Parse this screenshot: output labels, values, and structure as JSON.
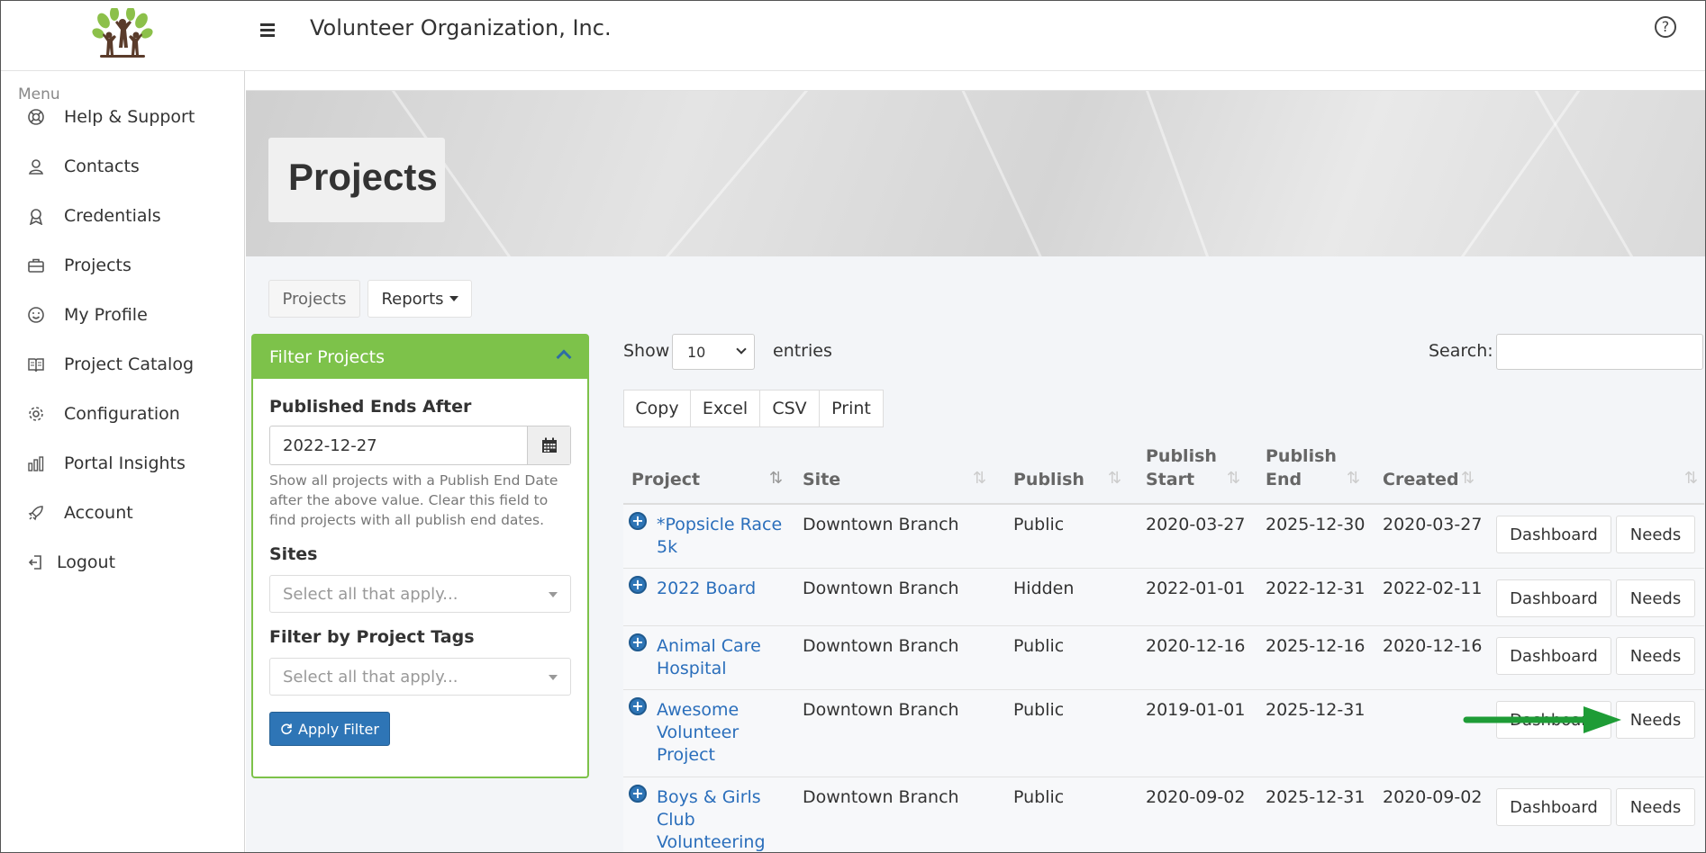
{
  "header": {
    "app_title": "Volunteer Organization, Inc.",
    "logo": "volunteer-tree-logo",
    "help_icon": "question-circle-icon"
  },
  "sidebar": {
    "menu_label": "Menu",
    "items": [
      {
        "label": "Help & Support",
        "icon": "lifebuoy-icon"
      },
      {
        "label": "Contacts",
        "icon": "contacts-icon"
      },
      {
        "label": "Credentials",
        "icon": "award-icon"
      },
      {
        "label": "Projects",
        "icon": "briefcase-icon"
      },
      {
        "label": "My Profile",
        "icon": "smile-icon"
      },
      {
        "label": "Project Catalog",
        "icon": "book-icon"
      },
      {
        "label": "Configuration",
        "icon": "gear-icon"
      },
      {
        "label": "Portal Insights",
        "icon": "bar-chart-icon"
      },
      {
        "label": "Account",
        "icon": "rocket-icon"
      },
      {
        "label": "Logout",
        "icon": "logout-icon"
      }
    ]
  },
  "page": {
    "title": "Projects",
    "tabs": [
      {
        "label": "Projects"
      },
      {
        "label": "Reports"
      }
    ]
  },
  "filter": {
    "title": "Filter Projects",
    "published_ends_after_label": "Published Ends After",
    "published_ends_after_value": "2022-12-27",
    "help_text": "Show all projects with a Publish End Date after the above value. Clear this field to find projects with all publish end dates.",
    "sites_label": "Sites",
    "sites_placeholder": "Select all that apply...",
    "tags_label": "Filter by Project Tags",
    "tags_placeholder": "Select all that apply...",
    "apply_label": "Apply Filter"
  },
  "table_controls": {
    "show_label": "Show",
    "page_size": "10",
    "entries_label": "entries",
    "search_label": "Search:",
    "search_value": "",
    "export_buttons": [
      "Copy",
      "Excel",
      "CSV",
      "Print"
    ]
  },
  "table": {
    "columns": {
      "project": "Project",
      "site": "Site",
      "publish": "Publish",
      "publish_start_1": "Publish",
      "publish_start_2": "Start",
      "publish_end_1": "Publish",
      "publish_end_2": "End",
      "created": "Created"
    },
    "rows": [
      {
        "project_lines": [
          "*Popsicle Race",
          "5k"
        ],
        "site": "Downtown Branch",
        "publish": "Public",
        "start": "2020-03-27",
        "end": "2025-12-30",
        "created": "2020-03-27",
        "dashboard": "Dashboard",
        "needs": "Needs"
      },
      {
        "project_lines": [
          "2022 Board"
        ],
        "site": "Downtown Branch",
        "publish": "Hidden",
        "start": "2022-01-01",
        "end": "2022-12-31",
        "created": "2022-02-11",
        "dashboard": "Dashboard",
        "needs": "Needs"
      },
      {
        "project_lines": [
          "Animal Care",
          "Hospital"
        ],
        "site": "Downtown Branch",
        "publish": "Public",
        "start": "2020-12-16",
        "end": "2025-12-16",
        "created": "2020-12-16",
        "dashboard": "Dashboard",
        "needs": "Needs"
      },
      {
        "project_lines": [
          "Awesome",
          "Volunteer",
          "Project"
        ],
        "site": "Downtown Branch",
        "publish": "Public",
        "start": "2019-01-01",
        "end": "2025-12-31",
        "created": "",
        "dashboard": "Dashboard",
        "needs": "Needs"
      },
      {
        "project_lines": [
          "Boys & Girls",
          "Club",
          "Volunteering"
        ],
        "site": "Downtown Branch",
        "publish": "Public",
        "start": "2020-09-02",
        "end": "2025-12-31",
        "created": "2020-09-02",
        "dashboard": "Dashboard",
        "needs": "Needs"
      }
    ]
  },
  "annotation": {
    "arrow_color": "#1e9c36",
    "arrow_icon": "green-arrow-annotation"
  },
  "colors": {
    "accent_green": "#7dc24a",
    "link_blue": "#2a6ebb",
    "button_blue": "#2e75b6"
  }
}
